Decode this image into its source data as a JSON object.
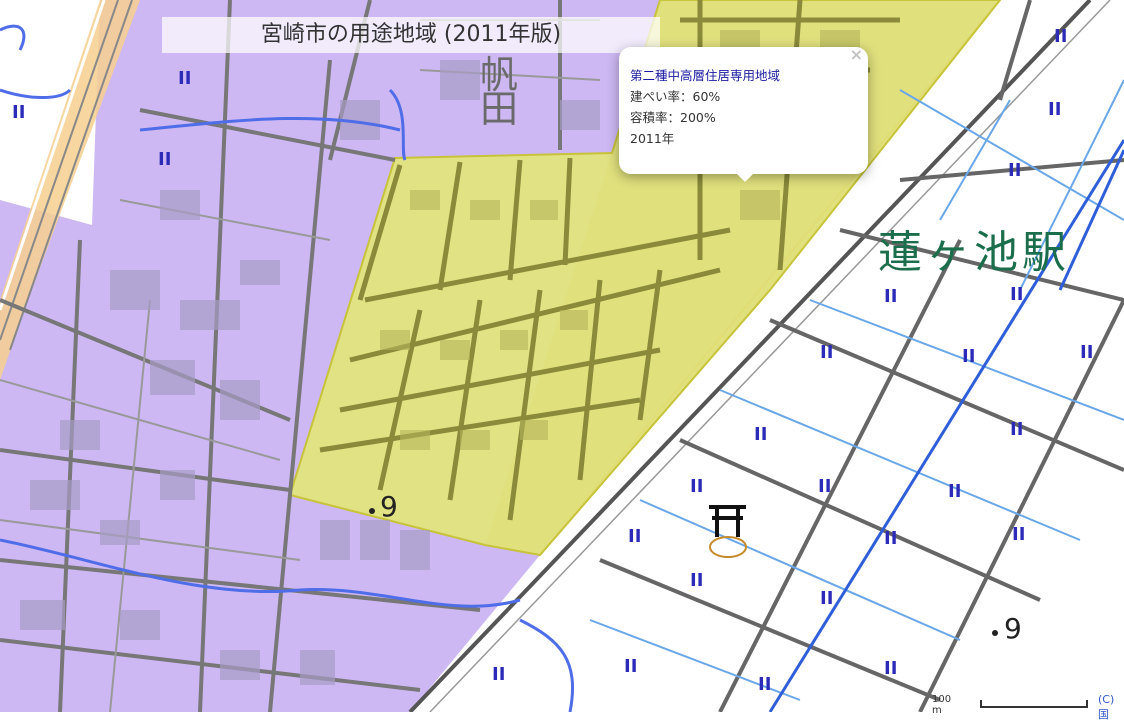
{
  "map": {
    "title": "宮崎市の用途地域 (2011年版)",
    "station_label": "蓮ヶ池駅",
    "field_label_top": "帆",
    "field_label": "田",
    "benchmark_label_left": "9",
    "benchmark_label_right": "9",
    "paddy_symbol": "II",
    "shrine_symbol": "⛩"
  },
  "popup": {
    "zone_name": "第二種中高層住居専用地域",
    "coverage": "建ぺい率：60%",
    "floor_ratio": "容積率：200%",
    "year": "2011年",
    "close_symbol": "×"
  },
  "scale": {
    "label": "100 m"
  },
  "attribution": "(C) 国",
  "colors": {
    "commercial_zone": "#c9b2f2",
    "residential_zone": "#dde07a",
    "residential_zone_border": "#c7c33a",
    "boundary_zone": "#f9d48f",
    "road_gray": "#777777",
    "river_blue": "#4f6de8",
    "water_blue": "#3b6fe0",
    "station_text": "#1b6e4b"
  }
}
